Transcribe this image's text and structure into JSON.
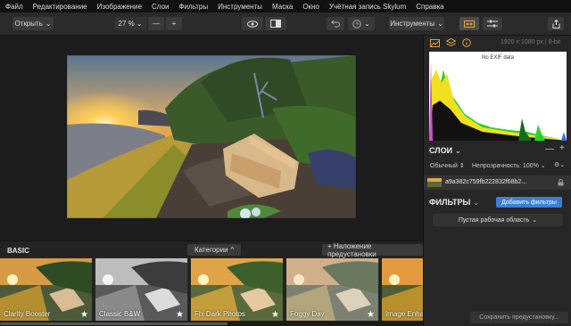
{
  "menu": [
    "Файл",
    "Редактирование",
    "Изображение",
    "Слои",
    "Фильтры",
    "Инструменты",
    "Маска",
    "Окно",
    "Учётная запись Skylum",
    "Справка"
  ],
  "toolbar": {
    "open_label": "Открыть",
    "zoom_value": "27 %",
    "zoom_out": "—",
    "zoom_in": "+",
    "tools_label": "Инструменты"
  },
  "presets": {
    "category_title": "BASIC",
    "categories_label": "Категории",
    "add_overlay_label": "+ Наложение предустановки",
    "items": [
      {
        "label": "Clarity Booster"
      },
      {
        "label": "Classic B&W"
      },
      {
        "label": "Fix Dark Photos"
      },
      {
        "label": "Foggy Day"
      },
      {
        "label": "Image Enhancer"
      }
    ],
    "star": "★"
  },
  "panel": {
    "image_info": "1920 x 1080 px  |  8-bit",
    "no_exif": "No EXIF data",
    "layers_title": "СЛОИ",
    "blend_mode": "Обычный",
    "opacity_label": "Непрозрачность: 100%",
    "layer_name": "a9a382c759fb222832f68b2...",
    "filters_title": "ФИЛЬТРЫ",
    "add_filters_label": "Добавить фильтры",
    "workspace_label": "Пустая рабочая область",
    "save_preset_label": "Сохранить предустановку..."
  },
  "colors": {
    "accent": "#3b7fd9",
    "background": "#1e1e1e",
    "panel": "#262626"
  }
}
